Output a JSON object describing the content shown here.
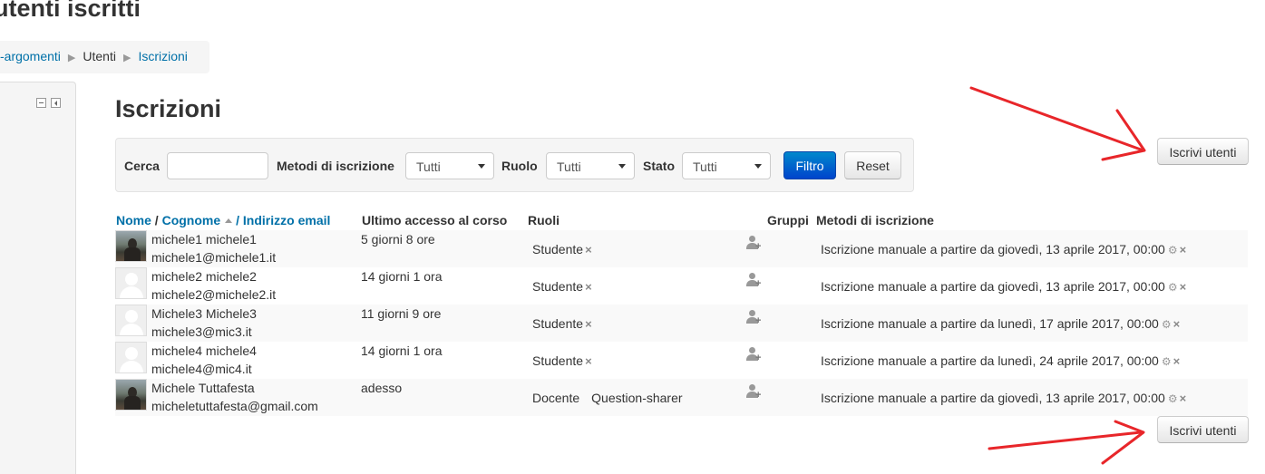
{
  "page": {
    "heading": "utenti iscritti",
    "breadcrumb": [
      "-argomenti",
      "Utenti",
      "Iscrizioni"
    ]
  },
  "main": {
    "title": "Iscrizioni",
    "enrol_button": "Iscrivi utenti"
  },
  "filter": {
    "search_label": "Cerca",
    "search_value": "",
    "methods_label": "Metodi di iscrizione",
    "methods_value": "Tutti",
    "role_label": "Ruolo",
    "role_value": "Tutti",
    "status_label": "Stato",
    "status_value": "Tutti",
    "filter_button": "Filtro",
    "reset_button": "Reset"
  },
  "table": {
    "headers": {
      "name": "Nome",
      "separator": "/",
      "surname": "Cognome",
      "email": "/ Indirizzo email",
      "last_access": "Ultimo accesso al corso",
      "roles": "Ruoli",
      "groups": "Gruppi",
      "methods": "Metodi di iscrizione"
    },
    "rows": [
      {
        "name": "michele1 michele1",
        "email": "michele1@michele1.it",
        "access": "5 giorni 8 ore",
        "roles": [
          "Studente"
        ],
        "method": "Iscrizione manuale a partire da giovedì, 13 aprile 2017, 00:00",
        "avatar": "photo"
      },
      {
        "name": "michele2 michele2",
        "email": "michele2@michele2.it",
        "access": "14 giorni 1 ora",
        "roles": [
          "Studente"
        ],
        "method": "Iscrizione manuale a partire da giovedì, 13 aprile 2017, 00:00",
        "avatar": "blank"
      },
      {
        "name": "Michele3 Michele3",
        "email": "michele3@mic3.it",
        "access": "11 giorni 9 ore",
        "roles": [
          "Studente"
        ],
        "method": "Iscrizione manuale a partire da lunedì, 17 aprile 2017, 00:00",
        "avatar": "blank"
      },
      {
        "name": "michele4 michele4",
        "email": "michele4@mic4.it",
        "access": "14 giorni 1 ora",
        "roles": [
          "Studente"
        ],
        "method": "Iscrizione manuale a partire da lunedì, 24 aprile 2017, 00:00",
        "avatar": "blank"
      },
      {
        "name": "Michele Tuttafesta",
        "email": "micheletuttafesta@gmail.com",
        "access": "adesso",
        "roles": [
          "Docente",
          "Question-sharer"
        ],
        "method": "Iscrizione manuale a partire da giovedì, 13 aprile 2017, 00:00",
        "avatar": "photo"
      }
    ]
  },
  "icons": {
    "remove": "×",
    "gear": "⚙",
    "add_group": "+"
  },
  "colors": {
    "link": "#0070a8",
    "primary": "#0055cc",
    "annotation_arrow": "#e8262a"
  }
}
